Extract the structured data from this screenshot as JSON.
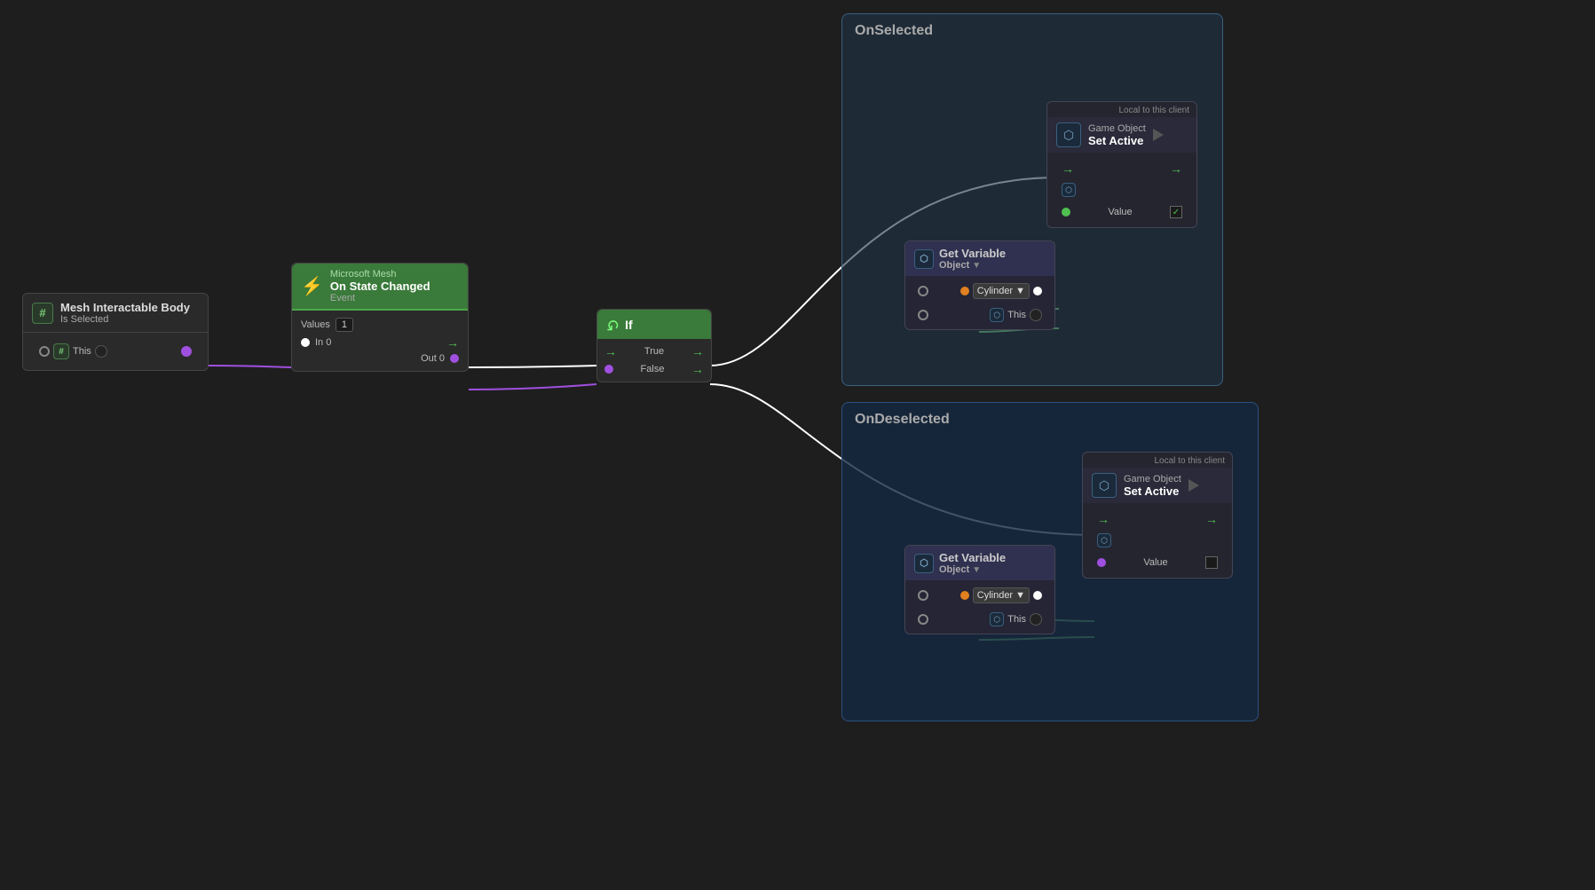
{
  "nodes": {
    "mesh_interactable": {
      "title": "Mesh Interactable Body",
      "subtitle": "Is Selected",
      "port_this": "This"
    },
    "microsoft_mesh": {
      "company": "Microsoft Mesh",
      "title": "On State Changed",
      "subtitle": "Event",
      "values_label": "Values",
      "values_count": "1",
      "in_port": "In 0",
      "out_port": "Out 0"
    },
    "if_node": {
      "title": "If",
      "true_label": "True",
      "false_label": "False"
    },
    "onselected": {
      "label": "OnSelected",
      "local_label": "Local to this client",
      "getvar": {
        "title": "Get Variable",
        "type": "Object",
        "row1_label": "Cylinder",
        "row2_label": "This"
      },
      "setactive": {
        "label1": "Game Object",
        "label2": "Set Active",
        "value_label": "Value",
        "checked": true
      }
    },
    "ondeselected": {
      "label": "OnDeselected",
      "local_label": "Local to this client",
      "getvar": {
        "title": "Get Variable",
        "type": "Object",
        "row1_label": "Cylinder",
        "row2_label": "This"
      },
      "setactive": {
        "label1": "Game Object",
        "label2": "Set Active",
        "value_label": "Value",
        "checked": false
      }
    }
  }
}
